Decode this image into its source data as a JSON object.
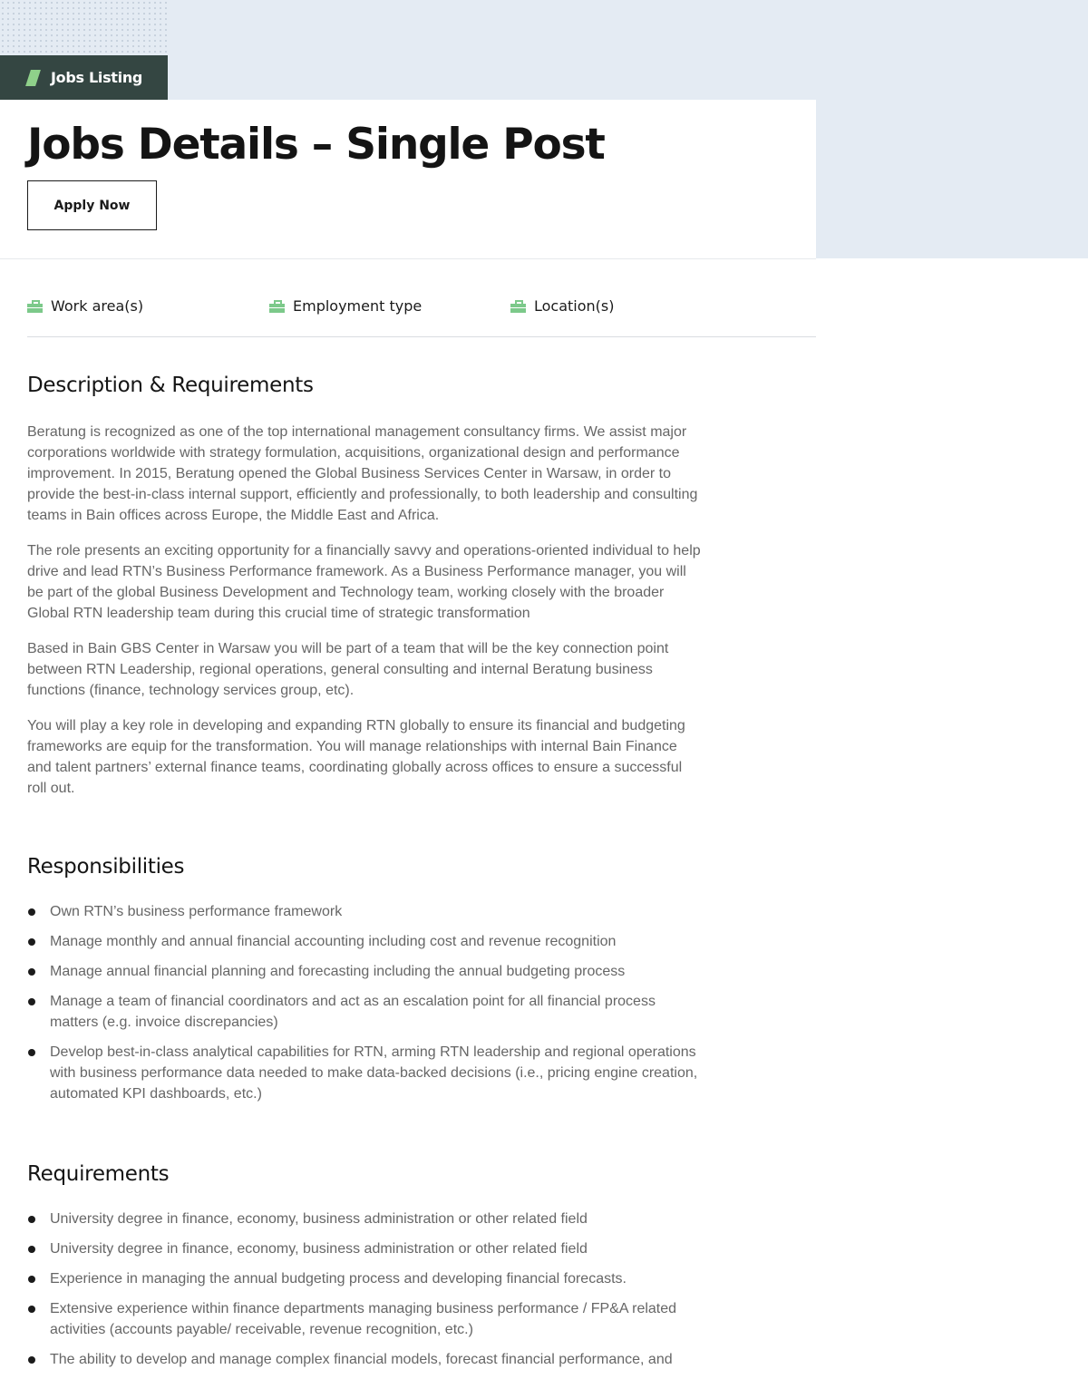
{
  "breadcrumb": {
    "label": "Jobs Listing"
  },
  "page": {
    "title": "Jobs Details – Single Post",
    "apply_label": "Apply Now"
  },
  "meta": {
    "work_area": "Work area(s)",
    "employment_type": "Employment type",
    "locations": "Location(s)",
    "icon": "briefcase-icon",
    "icon_color": "#7cc98a"
  },
  "description": {
    "heading": "Description & Requirements",
    "paragraphs": [
      "Beratung is recognized as one of the top international management consultancy firms. We assist major corporations worldwide with strategy formulation, acquisitions, organizational design and performance improvement. In 2015, Beratung opened the Global Business Services Center in Warsaw, in order to provide the best-in-class internal support, efficiently and professionally, to both leadership and consulting teams in Bain offices across Europe, the Middle East and Africa.",
      "The role presents an exciting opportunity for a financially savvy and operations-oriented individual to help drive and lead RTN’s Business Performance framework. As a Business Performance manager, you will be part of the global Business Development and Technology team, working closely with the broader Global RTN leadership team during this crucial time of strategic transformation",
      "Based in Bain GBS Center in Warsaw you will be part of a team that will be the key connection point between RTN Leadership, regional operations, general consulting and internal Beratung business functions (finance, technology services group, etc).",
      "You will play a key role in developing and expanding RTN globally to ensure its financial and budgeting frameworks are equip for the transformation. You will manage relationships with internal Bain Finance and talent partners’ external finance teams, coordinating globally across offices to ensure a successful roll out."
    ]
  },
  "responsibilities": {
    "heading": "Responsibilities",
    "items": [
      "Own RTN’s business performance framework",
      "Manage monthly and annual financial accounting including cost and revenue recognition",
      "Manage annual financial planning and forecasting including the annual budgeting process",
      "Manage a team of financial coordinators and act as an escalation point for all financial process matters (e.g. invoice discrepancies)",
      "Develop best-in-class analytical capabilities for RTN, arming RTN leadership and regional operations with business performance data needed to make data-backed decisions (i.e., pricing engine creation, automated KPI dashboards, etc.)"
    ]
  },
  "requirements": {
    "heading": "Requirements",
    "items": [
      "University degree in finance, economy, business administration or other related field",
      "University degree in finance, economy, business administration or other related field",
      "Experience in managing the annual budgeting process and developing financial forecasts.",
      "Extensive experience within finance departments managing business performance / FP&A related activities (accounts payable/ receivable, revenue recognition, etc.)",
      "The ability to develop and manage complex financial models, forecast financial performance, and"
    ]
  },
  "colors": {
    "accent": "#7cc98a",
    "dark_band": "#344642",
    "hero_bg": "#e4ebf3"
  }
}
